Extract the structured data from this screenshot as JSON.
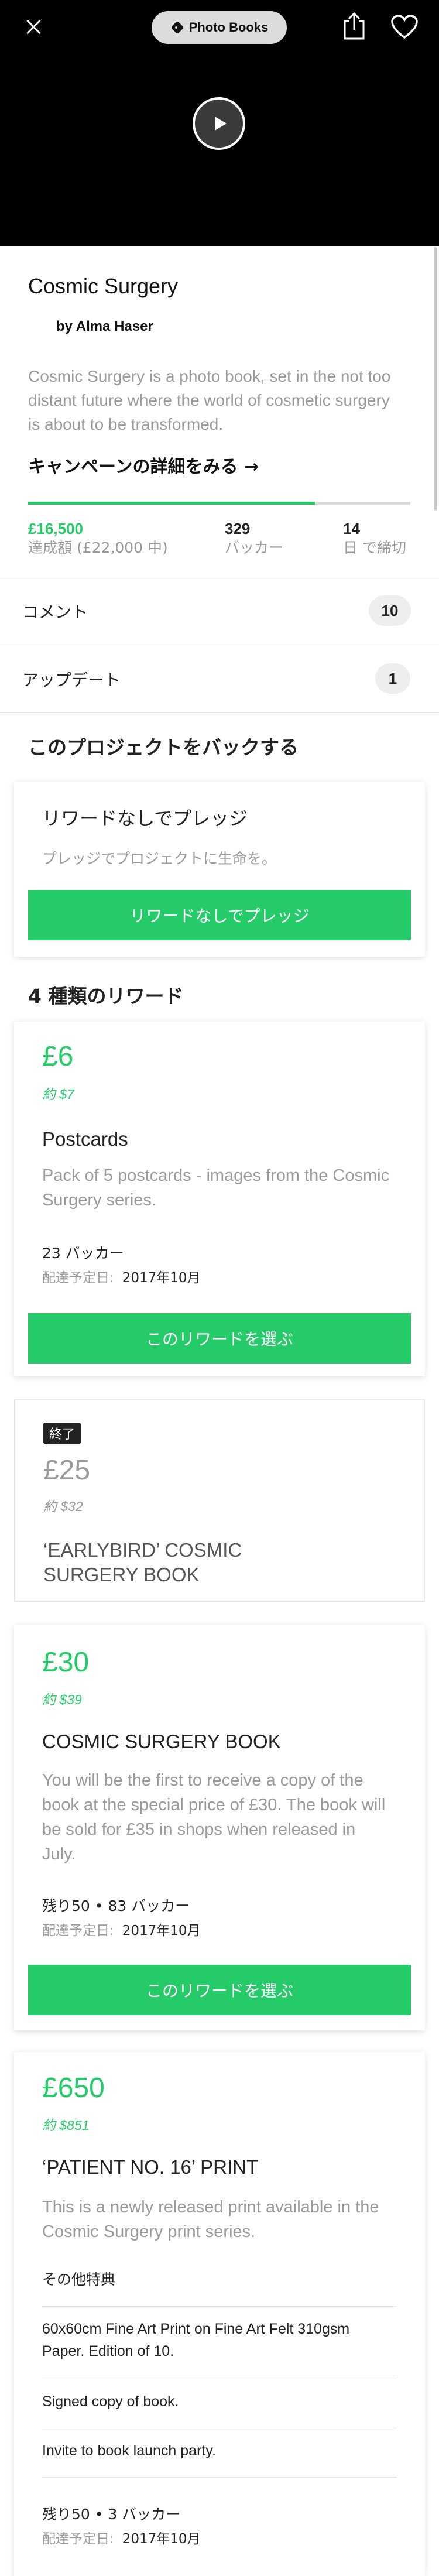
{
  "header": {
    "category": "Photo Books",
    "close_icon": "close-icon",
    "tag_icon": "tag-icon",
    "share_icon": "share-icon",
    "heart_icon": "heart-icon",
    "play_icon": "play-icon"
  },
  "project": {
    "title": "Cosmic Surgery",
    "author": "by Alma Haser",
    "blurb": "Cosmic Surgery is a photo book, set in the not too distant future where the world of cosmetic surgery is about to be transformed.",
    "campaign_link": "キャンペーンの詳細をみる →"
  },
  "stats": {
    "pledged": "£16,500",
    "pledged_label": "達成額 (£22,000 中)",
    "progress_fraction": 0.75,
    "backers": "329",
    "backers_label": "バッカー",
    "days": "14",
    "days_label": "日 で締切"
  },
  "rows": {
    "comments_label": "コメント",
    "comments_count": "10",
    "updates_label": "アップデート",
    "updates_count": "1"
  },
  "back_section": {
    "heading": "このプロジェクトをバックする",
    "no_reward_title": "リワードなしでプレッジ",
    "no_reward_desc": "プレッジでプロジェクトに生命を。",
    "no_reward_button": "リワードなしでプレッジ"
  },
  "rewards_heading": "4 種類のリワード",
  "rewards": [
    {
      "price": "£6",
      "approx": "約 $7",
      "title": "Postcards",
      "desc": "Pack of 5 postcards - images from the Cosmic Surgery series.",
      "backers": "23 バッカー",
      "ship_label": "配達予定日:",
      "ship_date": "2017年10月",
      "button": "このリワードを選ぶ"
    },
    {
      "badge": "終了",
      "price": "£25",
      "approx": "約 $32",
      "title": "‘EARLYBIRD’ COSMIC SURGERY BOOK"
    },
    {
      "price": "£30",
      "approx": "約 $39",
      "title": "COSMIC SURGERY BOOK",
      "desc": "You will be the first to receive a copy of the book at the special price of £30. The book will be sold for £35 in shops when released in July.",
      "backers": "残り50 • 83 バッカー",
      "ship_label": "配達予定日:",
      "ship_date": "2017年10月",
      "button": "このリワードを選ぶ"
    },
    {
      "price": "£650",
      "approx": "約 $851",
      "title": "‘PATIENT NO. 16’ PRINT",
      "desc": "This is a newly released print available in the Cosmic Surgery print series.",
      "extras_label": "その他特典",
      "extras": [
        "60x60cm Fine Art Print on Fine Art Felt 310gsm Paper. Edition of 10.",
        "Signed copy of book.",
        "Invite to book launch party."
      ],
      "backers": "残り50 • 3 バッカー",
      "ship_label": "配達予定日:",
      "ship_date": "2017年10月"
    }
  ],
  "colors": {
    "accent": "#25cb68",
    "muted_text": "#9a9a9a",
    "video_bg": "#000000"
  }
}
